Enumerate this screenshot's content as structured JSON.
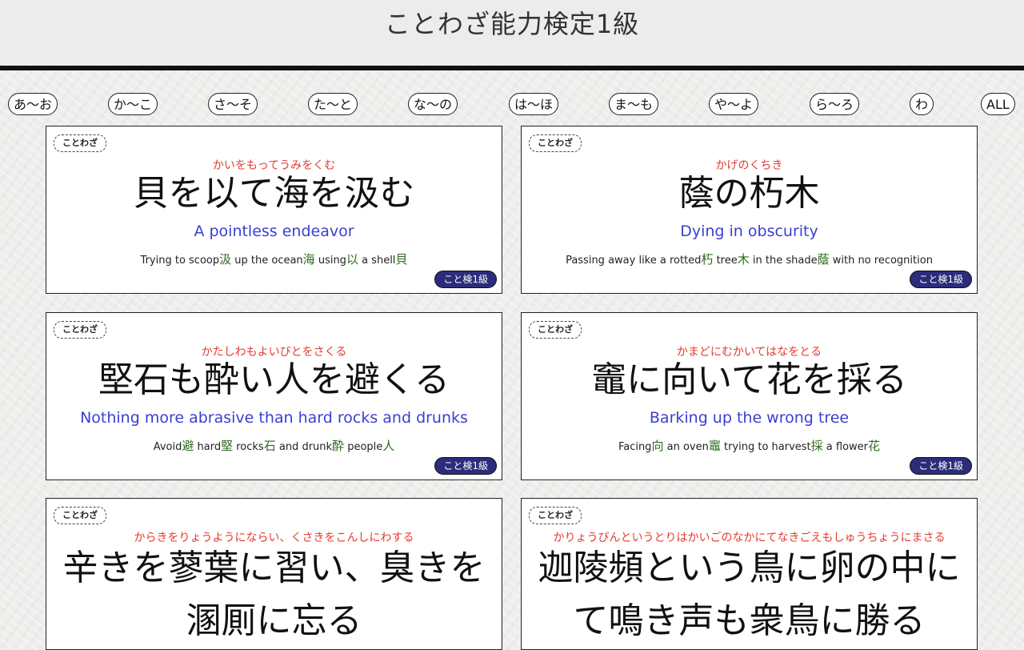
{
  "header": {
    "title": "ことわざ能力検定1級"
  },
  "nav": {
    "items": [
      "あ〜お",
      "か〜こ",
      "さ〜そ",
      "た〜と",
      "な〜の",
      "は〜ほ",
      "ま〜も",
      "や〜よ",
      "ら〜ろ",
      "わ",
      "ALL"
    ]
  },
  "cards": [
    {
      "tag": "ことわざ",
      "reading": "かいをもってうみをくむ",
      "phrase": "貝を以て海を汲む",
      "meaning": "A pointless endeavor",
      "literal": [
        {
          "t": "Trying to scoop"
        },
        {
          "k": "汲"
        },
        {
          "t": " up the ocean"
        },
        {
          "k": "海"
        },
        {
          "t": " using"
        },
        {
          "k": "以"
        },
        {
          "t": " a shell"
        },
        {
          "k": "貝"
        }
      ],
      "badge": "こと検1級"
    },
    {
      "tag": "ことわざ",
      "reading": "かげのくちき",
      "phrase": "蔭の朽木",
      "meaning": "Dying in obscurity",
      "literal": [
        {
          "t": "Passing away like a rotted"
        },
        {
          "k": "朽"
        },
        {
          "t": " tree"
        },
        {
          "k": "木"
        },
        {
          "t": " in the shade"
        },
        {
          "k": "蔭"
        },
        {
          "t": " with no recognition"
        }
      ],
      "badge": "こと検1級"
    },
    {
      "tag": "ことわざ",
      "reading": "かたしわもよいびとをさくる",
      "phrase": "堅石も酔い人を避くる",
      "meaning": "Nothing more abrasive than hard rocks and drunks",
      "literal": [
        {
          "t": "Avoid"
        },
        {
          "k": "避"
        },
        {
          "t": " hard"
        },
        {
          "k": "堅"
        },
        {
          "t": " rocks"
        },
        {
          "k": "石"
        },
        {
          "t": " and drunk"
        },
        {
          "k": "酔"
        },
        {
          "t": " people"
        },
        {
          "k": "人"
        }
      ],
      "badge": "こと検1級"
    },
    {
      "tag": "ことわざ",
      "reading": "かまどにむかいてはなをとる",
      "phrase": "竈に向いて花を採る",
      "meaning": "Barking up the wrong tree",
      "literal": [
        {
          "t": "Facing"
        },
        {
          "k": "向"
        },
        {
          "t": " an oven"
        },
        {
          "k": "竈"
        },
        {
          "t": " trying to harvest"
        },
        {
          "k": "採"
        },
        {
          "t": " a flower"
        },
        {
          "k": "花"
        }
      ],
      "badge": "こと検1級"
    },
    {
      "tag": "ことわざ",
      "reading": "からきをりょうようにならい、くさきをこんしにわする",
      "phrase": "辛きを蓼葉に習い、臭きを溷厠に忘る",
      "meaning": "",
      "literal": [],
      "badge": ""
    },
    {
      "tag": "ことわざ",
      "reading": "かりょうびんというとりはかいごのなかにてなきごえもしゅうちょうにまさる",
      "phrase": "迦陵頻という鳥に卵の中にて鳴き声も衆鳥に勝る",
      "meaning": "",
      "literal": [],
      "badge": ""
    }
  ]
}
